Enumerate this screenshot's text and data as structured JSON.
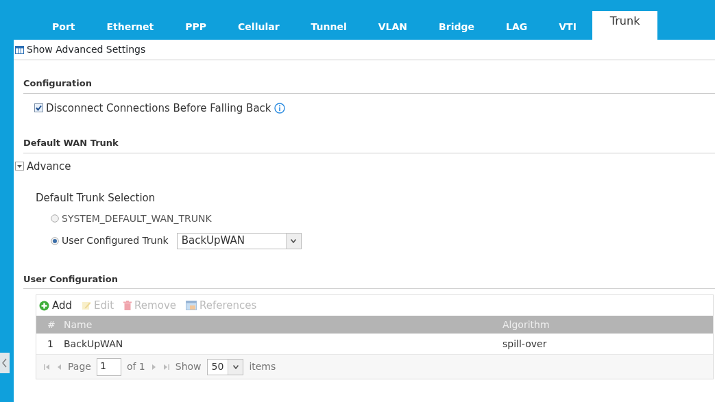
{
  "tabs": [
    {
      "label": "Port",
      "selected": false
    },
    {
      "label": "Ethernet",
      "selected": false
    },
    {
      "label": "PPP",
      "selected": false
    },
    {
      "label": "Cellular",
      "selected": false
    },
    {
      "label": "Tunnel",
      "selected": false
    },
    {
      "label": "VLAN",
      "selected": false
    },
    {
      "label": "Bridge",
      "selected": false
    },
    {
      "label": "LAG",
      "selected": false
    },
    {
      "label": "VTI",
      "selected": false
    },
    {
      "label": "Trunk",
      "selected": true
    }
  ],
  "show_advanced": "Show Advanced Settings",
  "configuration": {
    "title": "Configuration",
    "checkbox": {
      "label": "Disconnect Connections Before Falling Back",
      "checked": true
    }
  },
  "default_wan_trunk": {
    "title": "Default WAN Trunk",
    "advance": {
      "label": "Advance",
      "expanded": true
    },
    "selection_label": "Default Trunk Selection",
    "options": [
      {
        "label": "SYSTEM_DEFAULT_WAN_TRUNK",
        "selected": false
      },
      {
        "label": "User Configured Trunk",
        "selected": true,
        "value": "BackUpWAN"
      }
    ]
  },
  "user_configuration": {
    "title": "User Configuration",
    "toolbar": [
      {
        "kind": "add",
        "label": "Add",
        "disabled": false
      },
      {
        "kind": "edit",
        "label": "Edit",
        "disabled": true
      },
      {
        "kind": "remove",
        "label": "Remove",
        "disabled": true
      },
      {
        "kind": "references",
        "label": "References",
        "disabled": true
      }
    ],
    "table": {
      "columns": [
        "#",
        "Name",
        "Algorithm"
      ],
      "rows": [
        [
          "1",
          "BackUpWAN",
          "spill-over"
        ]
      ]
    },
    "pager": {
      "page_label": "Page",
      "page": "1",
      "of": "of 1",
      "show_label": "Show",
      "per_page": "50",
      "items_label": "items"
    }
  }
}
